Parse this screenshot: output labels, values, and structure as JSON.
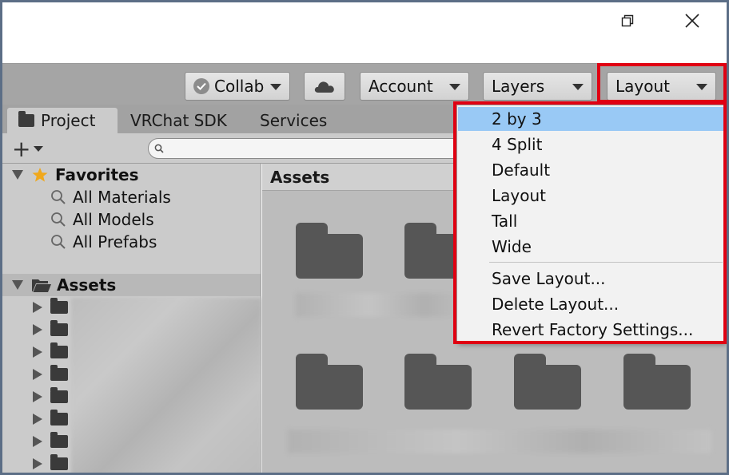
{
  "window": {
    "controls": {
      "restore_icon": "restore-icon",
      "close_icon": "close-icon"
    }
  },
  "toolbar": {
    "collab_label": "Collab",
    "account_label": "Account",
    "layers_label": "Layers",
    "layout_label": "Layout",
    "cloud_icon": "cloud-icon"
  },
  "tabs": [
    {
      "label": "Project"
    },
    {
      "label": "VRChat SDK"
    },
    {
      "label": "Services"
    }
  ],
  "search": {
    "value": ""
  },
  "sidebar": {
    "favorites_label": "Favorites",
    "favorites": [
      {
        "label": "All Materials"
      },
      {
        "label": "All Models"
      },
      {
        "label": "All Prefabs"
      }
    ],
    "assets_label": "Assets"
  },
  "main": {
    "breadcrumb": "Assets"
  },
  "layout_menu": {
    "items": [
      {
        "label": "2 by 3",
        "selected": true
      },
      {
        "label": "4 Split"
      },
      {
        "label": "Default"
      },
      {
        "label": "Layout"
      },
      {
        "label": "Tall"
      },
      {
        "label": "Wide"
      }
    ],
    "actions": [
      {
        "label": "Save Layout..."
      },
      {
        "label": "Delete Layout..."
      },
      {
        "label": "Revert Factory Settings..."
      }
    ],
    "highlight_color": "#99c9f5",
    "annotation_color": "#e00012"
  }
}
